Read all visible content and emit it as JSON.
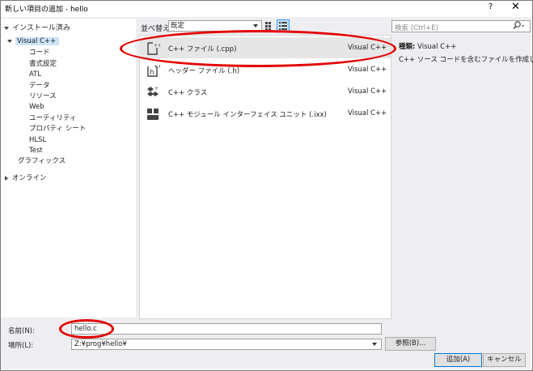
{
  "window": {
    "title": "新しい項目の追加 - hello",
    "help_glyph": "?",
    "close_glyph": "✕"
  },
  "left": {
    "header": "インストール済み",
    "tree": [
      {
        "label": "Visual C++",
        "selected": true
      },
      {
        "label": "コード"
      },
      {
        "label": "書式設定"
      },
      {
        "label": "ATL"
      },
      {
        "label": "データ"
      },
      {
        "label": "リソース"
      },
      {
        "label": "Web"
      },
      {
        "label": "ユーティリティ"
      },
      {
        "label": "プロパティ シート"
      },
      {
        "label": "HLSL"
      },
      {
        "label": "Test"
      },
      {
        "label": "グラフィックス"
      }
    ],
    "online": "オンライン"
  },
  "middle": {
    "sort_label": "並べ替え:",
    "sort_value": "既定",
    "templates": [
      {
        "name": "C++ ファイル (.cpp)",
        "lang": "Visual C++",
        "icon": "cpp-file-icon",
        "selected": true
      },
      {
        "name": "ヘッダー ファイル (.h)",
        "lang": "Visual C++",
        "icon": "header-file-icon"
      },
      {
        "name": "C++ クラス",
        "lang": "Visual C++",
        "icon": "class-icon"
      },
      {
        "name": "C++ モジュール インターフェイス ユニット (.ixx)",
        "lang": "Visual C++",
        "icon": "module-icon"
      }
    ]
  },
  "right": {
    "search_placeholder": "検索 (Ctrl+E)",
    "type_label": "種類:",
    "type_value": "Visual C++",
    "description": "C++ ソース コードを含むファイルを作成します"
  },
  "bottom": {
    "name_label": "名前(N):",
    "name_value": "hello.c",
    "location_label": "場所(L):",
    "location_value": "Z:¥prog¥hello¥",
    "browse_label": "参照(B)...",
    "add_label": "追加(A)",
    "cancel_label": "キャンセル"
  },
  "colors": {
    "annotation": "#e20000",
    "selection": "#cce4f7",
    "accent": "#0078d7"
  }
}
